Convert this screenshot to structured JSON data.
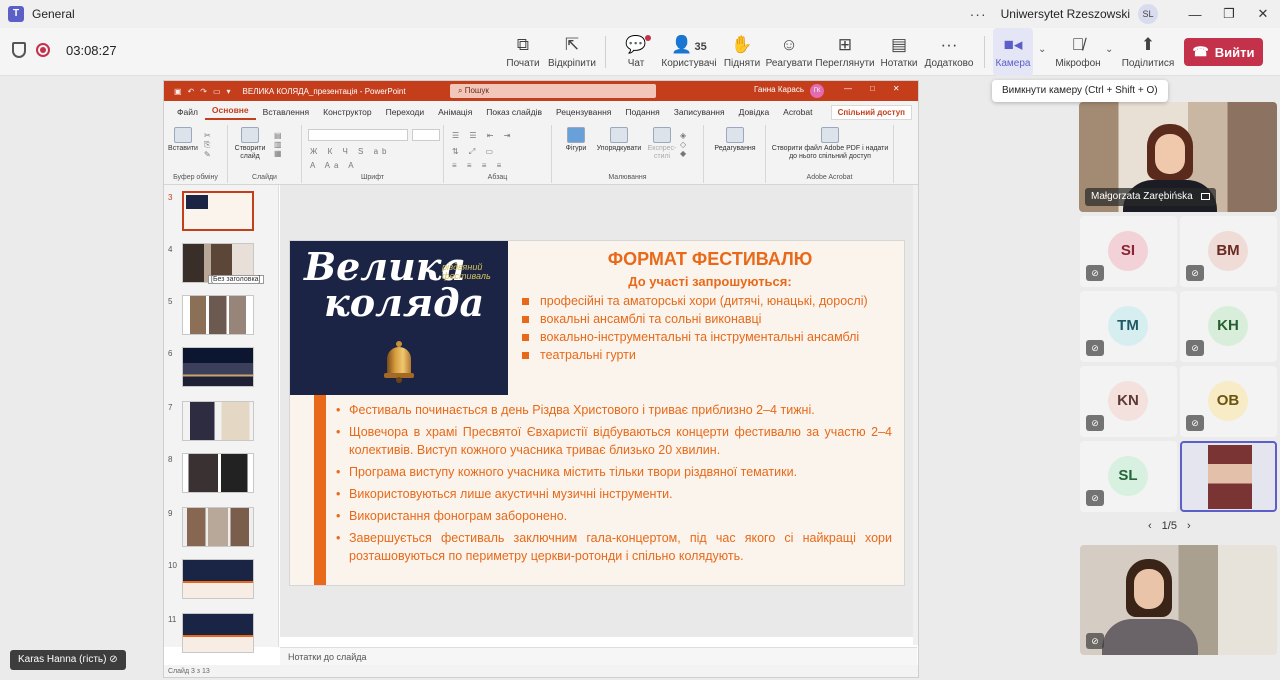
{
  "window": {
    "title": "General",
    "org": "Uniwersytet Rzeszowski",
    "org_initials": "SL"
  },
  "meeting": {
    "timer": "03:08:27",
    "toolbar": {
      "start": "Почати",
      "popout": "Відкріпити",
      "chat": "Чат",
      "people": "Користувачі",
      "people_count": "35",
      "raise": "Підняти",
      "react": "Реагувати",
      "view": "Переглянути",
      "notes": "Нотатки",
      "more": "Додатково",
      "camera": "Камера",
      "mic": "Мікрофон",
      "share": "Поділитися",
      "leave": "Вийти"
    },
    "tooltip": "Вимкнути камеру (Ctrl + Shift + O)",
    "self_label": "Karas Hanna (гість)"
  },
  "ppt": {
    "doc_title": "ВЕЛИКА КОЛЯДА_презентація  -  PowerPoint",
    "search": "Пошук",
    "user": "Ганна Карась",
    "user_initials": "ГК",
    "tabs": [
      "Файл",
      "Основне",
      "Вставлення",
      "Конструктор",
      "Переходи",
      "Анімація",
      "Показ слайдів",
      "Рецензування",
      "Подання",
      "Записування",
      "Довідка",
      "Acrobat"
    ],
    "share_label": "Спільний доступ",
    "ribbon": {
      "paste": "Вставити",
      "new_slide": "Створити слайд",
      "clipboard": "Буфер обміну",
      "slides": "Слайди",
      "font": "Шрифт",
      "paragraph": "Абзац",
      "shapes": "Фігури",
      "arrange": "Упорядкувати",
      "styles": "Експрес-стилі",
      "drawing": "Малювання",
      "editing": "Редагування",
      "acrobat_action": "Створити файл Adobe PDF і надати до нього спільний доступ",
      "acrobat_group": "Adobe Acrobat"
    },
    "thumbs": [
      "3",
      "4",
      "5",
      "6",
      "7",
      "8",
      "9",
      "10",
      "11"
    ],
    "thumb_tooltip": "[Без заголовка]",
    "notes_placeholder": "Нотатки до слайда",
    "status": "Слайд 3 з 13"
  },
  "slide": {
    "logo_line1": "Велика",
    "logo_line2": "коляда",
    "logo_sub1": "різдвяний",
    "logo_sub2": "фестиваль",
    "title": "ФОРМАТ ФЕСТИВАЛЮ",
    "subtitle": "До участі запрошуються:",
    "invited": [
      "професійні та аматорські хори (дитячі, юнацькі, дорослі)",
      "вокальні ансамблі та сольні виконавці",
      "вокально-інструментальні та інструментальні ансамблі",
      "театральні гурти"
    ],
    "body": [
      "Фестиваль починається в день Різдва Христового і триває приблизно 2–4 тижні.",
      "Щовечора в храмі Пресвятої Євхаристії відбуваються концерти фестивалю за участю 2–4 колективів. Виступ кожного учасника триває близько 20 хвилин.",
      "Програма виступу кожного учасника містить тільки твори різдвяної тематики.",
      "Використовуються лише акустичні музичні інструменти.",
      "Використання фонограм заборонено.",
      "Завершується фестиваль заключним гала-концертом, під час якого сі найкращі хори розташовуються по периметру церкви-ротонди і спільно колядують."
    ]
  },
  "participants": {
    "featured": "Małgorzata Zarębińska",
    "tiles": [
      {
        "initials": "SI",
        "color": "#e8a0a8",
        "text": "#8a2434"
      },
      {
        "initials": "BM",
        "color": "#f0c8c0",
        "text": "#6a2a24"
      },
      {
        "initials": "TM",
        "color": "#bfe6ea",
        "text": "#1d5a64"
      },
      {
        "initials": "KH",
        "color": "#c8e8cc",
        "text": "#275e31"
      },
      {
        "initials": "KN",
        "color": "#f2d2cc",
        "text": "#5c3a34"
      },
      {
        "initials": "OB",
        "color": "#f6e4a8",
        "text": "#6a5410"
      },
      {
        "initials": "SL",
        "color": "#c8ecd4",
        "text": "#24653c"
      }
    ],
    "pager": "1/5"
  },
  "colors": {
    "accent": "#5b5fc7",
    "leave": "#c4314b",
    "ppt": "#c43e1c",
    "slide_orange": "#e8691a",
    "slide_navy": "#1c2445"
  },
  "icons": [
    "shield-icon",
    "record-icon",
    "camera-icon",
    "mic-off-icon",
    "share-icon",
    "chat-icon",
    "people-icon",
    "hand-icon",
    "emoji-icon",
    "grid-icon",
    "notes-icon",
    "more-icon",
    "phone-icon"
  ]
}
